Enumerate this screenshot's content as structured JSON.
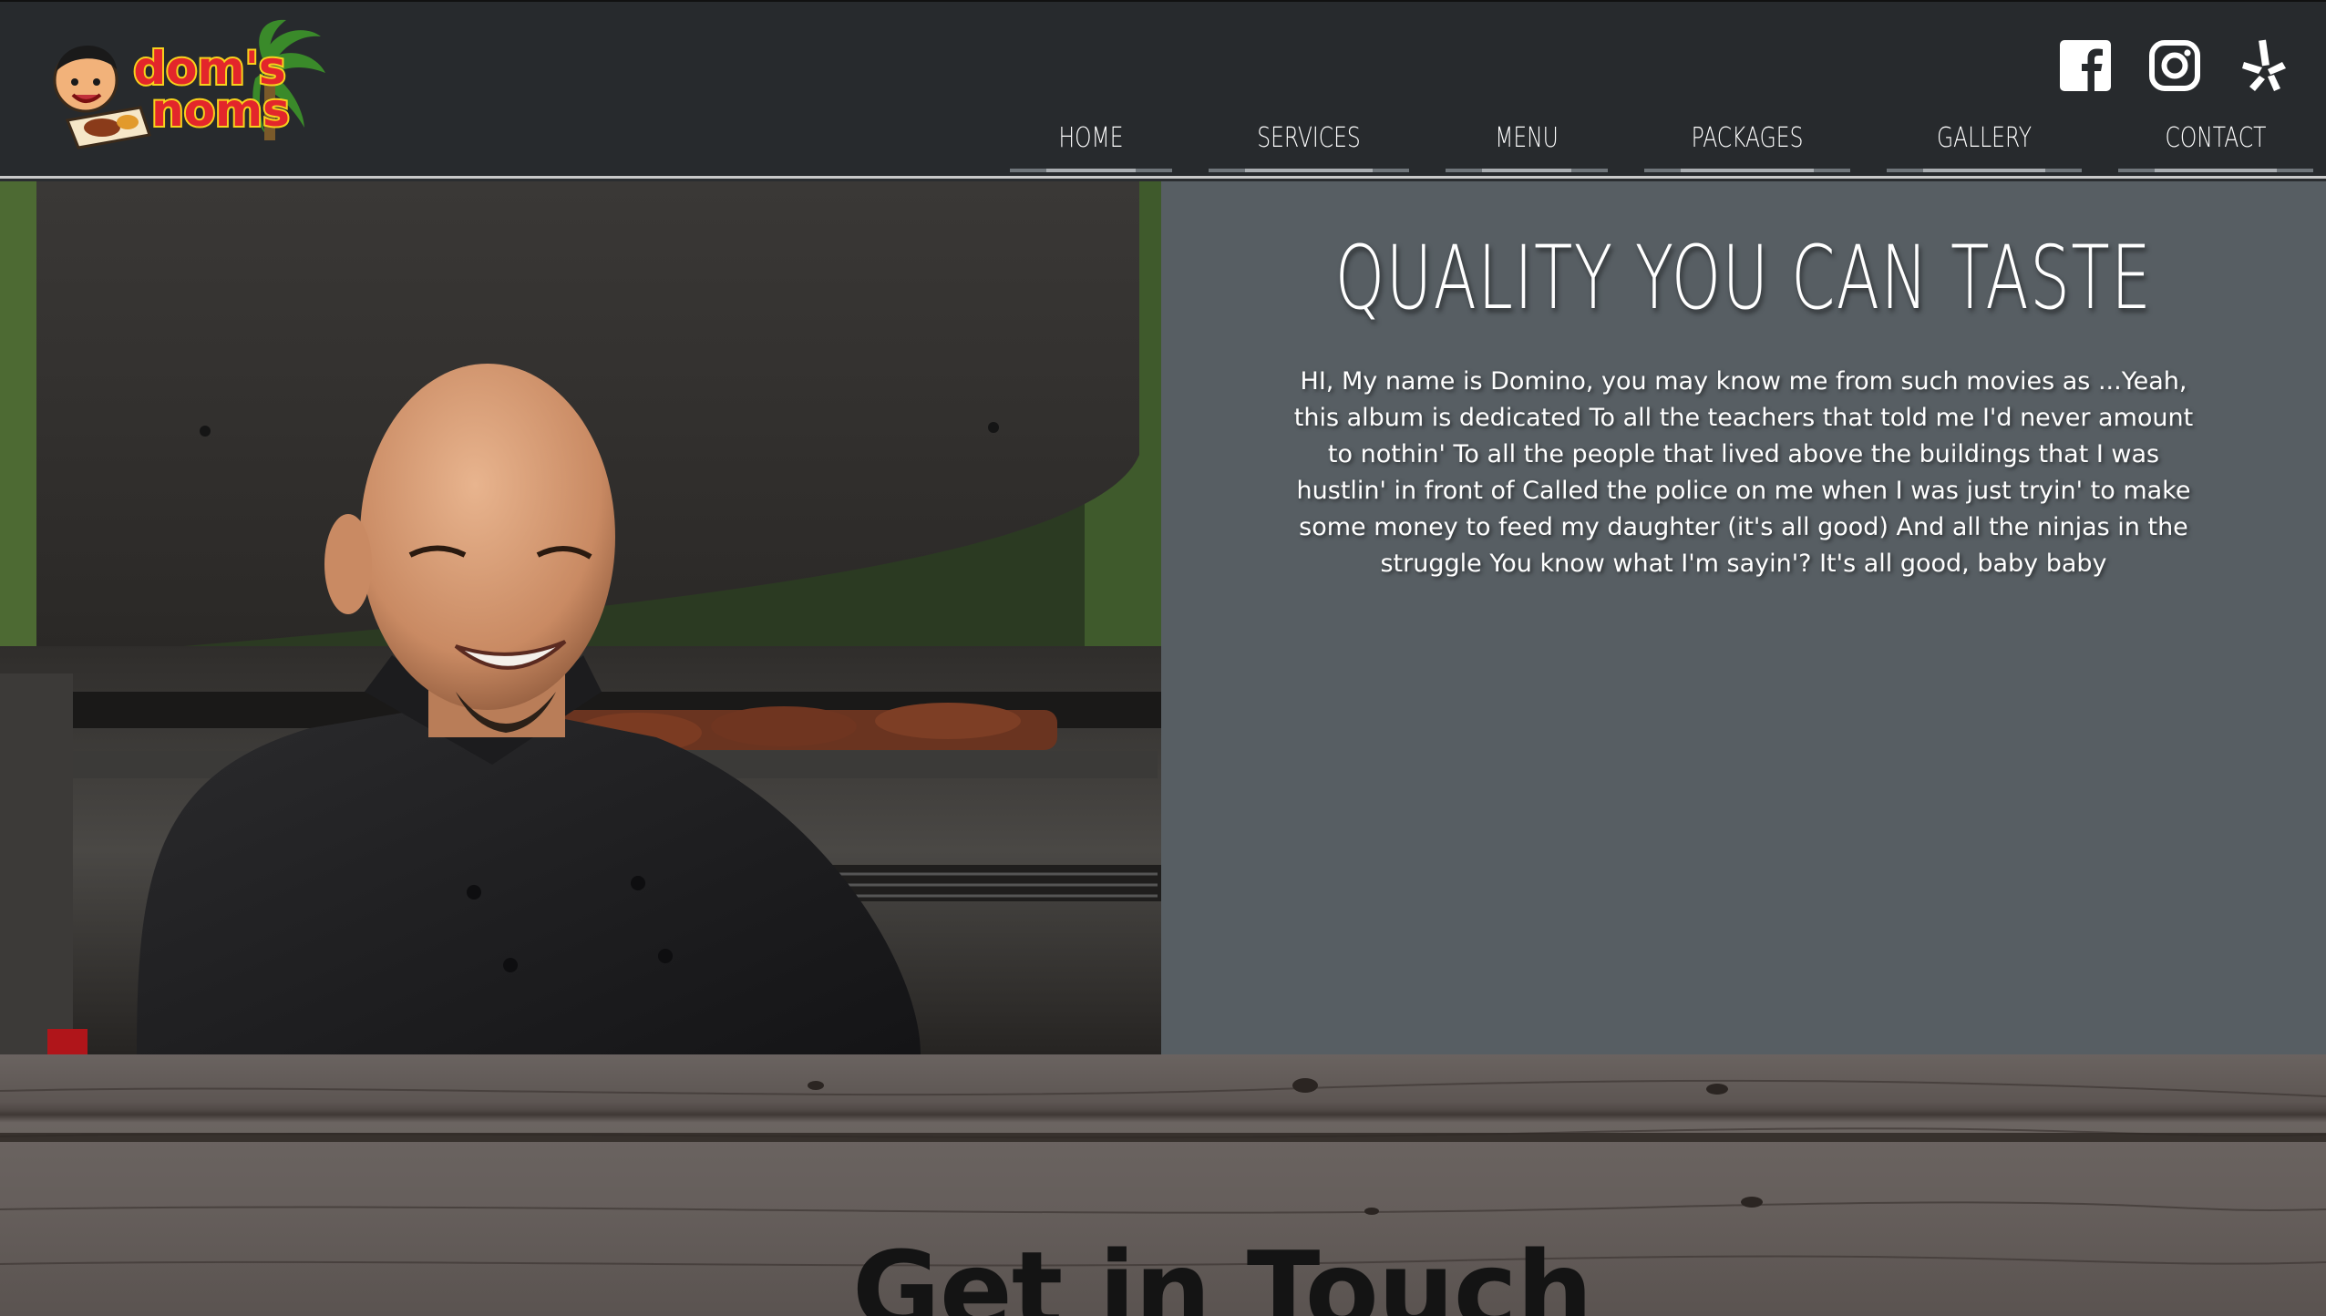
{
  "brand": {
    "logo_line1": "dom's",
    "logo_line2": "noms"
  },
  "social": [
    {
      "name": "facebook-icon"
    },
    {
      "name": "instagram-icon"
    },
    {
      "name": "yelp-icon"
    }
  ],
  "nav": {
    "items": [
      {
        "label": "HOME"
      },
      {
        "label": "SERVICES"
      },
      {
        "label": "MENU"
      },
      {
        "label": "PACKAGES"
      },
      {
        "label": "GALLERY"
      },
      {
        "label": "CONTACT"
      }
    ]
  },
  "hero": {
    "title": "QUALITY YOU CAN TASTE",
    "body": "HI, My name is Domino, you may know me from such movies as ...Yeah, this album is dedicated To all the teachers that told me I'd never amount to nothin' To all the people that lived above the buildings that I was hustlin' in front of Called the police on me when I was just tryin' to make some money to feed my daughter (it's all good) And all the ninjas in the struggle You know what I'm sayin'? It's all good, baby baby"
  },
  "contact": {
    "title": "Get in Touch"
  },
  "colors": {
    "header_bg": "#272a2d",
    "panel_bg": "#575e63",
    "logo_red": "#e3262b",
    "logo_yellow": "#f7d21c"
  }
}
